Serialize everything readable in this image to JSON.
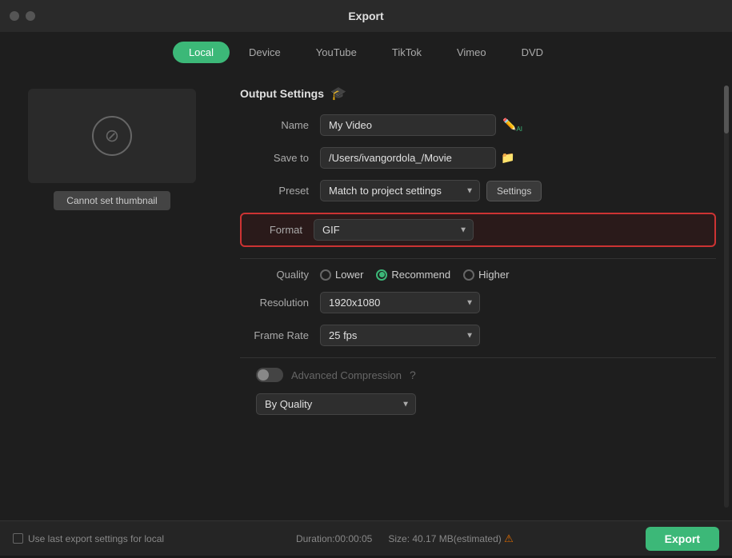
{
  "titleBar": {
    "title": "Export"
  },
  "tabs": [
    {
      "id": "local",
      "label": "Local",
      "active": true
    },
    {
      "id": "device",
      "label": "Device",
      "active": false
    },
    {
      "id": "youtube",
      "label": "YouTube",
      "active": false
    },
    {
      "id": "tiktok",
      "label": "TikTok",
      "active": false
    },
    {
      "id": "vimeo",
      "label": "Vimeo",
      "active": false
    },
    {
      "id": "dvd",
      "label": "DVD",
      "active": false
    }
  ],
  "outputSettings": {
    "sectionTitle": "Output Settings",
    "nameLabel": "Name",
    "nameValue": "My Video",
    "saveToLabel": "Save to",
    "saveToValue": "/Users/ivangordola_/Movie",
    "presetLabel": "Preset",
    "presetValue": "Match to project settings",
    "settingsBtnLabel": "Settings",
    "formatLabel": "Format",
    "formatValue": "GIF",
    "qualityLabel": "Quality",
    "qualityOptions": [
      {
        "id": "lower",
        "label": "Lower",
        "active": false
      },
      {
        "id": "recommend",
        "label": "Recommend",
        "active": true
      },
      {
        "id": "higher",
        "label": "Higher",
        "active": false
      }
    ],
    "resolutionLabel": "Resolution",
    "resolutionValue": "1920x1080",
    "frameRateLabel": "Frame Rate",
    "frameRateValue": "25 fps",
    "advancedCompressionLabel": "Advanced Compression",
    "byQualityValue": "By Quality"
  },
  "thumbnail": {
    "btnLabel": "Cannot set thumbnail"
  },
  "footer": {
    "checkboxLabel": "Use last export settings for local",
    "duration": "Duration:00:00:05",
    "size": "Size: 40.17 MB(estimated)",
    "exportLabel": "Export"
  }
}
